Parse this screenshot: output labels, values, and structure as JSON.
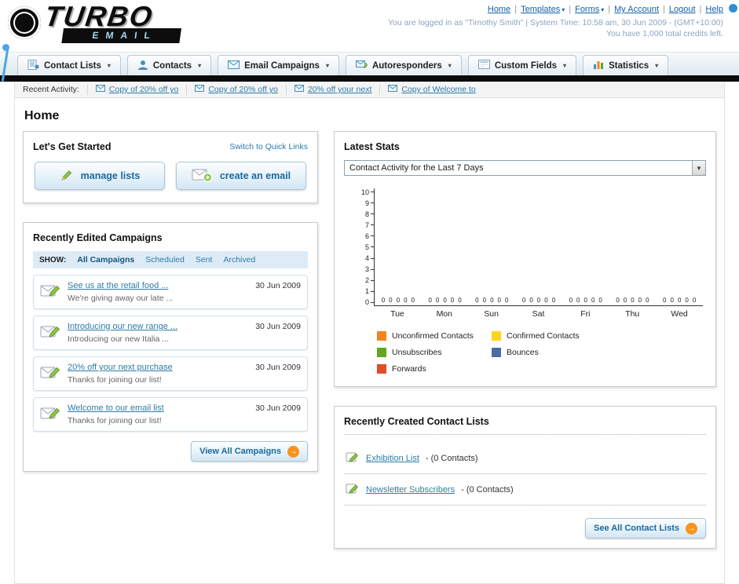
{
  "header": {
    "logo_title": "TURBO",
    "logo_subtitle": "EMAIL",
    "nav": {
      "items": [
        {
          "label": "Home",
          "has_dropdown": false
        },
        {
          "label": "Templates",
          "has_dropdown": true
        },
        {
          "label": "Forms",
          "has_dropdown": true
        },
        {
          "label": "My Account",
          "has_dropdown": false
        },
        {
          "label": "Logout",
          "has_dropdown": false
        },
        {
          "label": "Help",
          "has_dropdown": false
        }
      ]
    },
    "session_line": "You are logged in as \"Timothy Smith\" | System Time: 10:58 am, 30 Jun 2009 - (GMT+10:00)",
    "credits_line": "You have 1,000 total credits left."
  },
  "main_nav": {
    "tabs": [
      {
        "label": "Contact Lists",
        "icon": "contact-lists-icon"
      },
      {
        "label": "Contacts",
        "icon": "contacts-icon"
      },
      {
        "label": "Email Campaigns",
        "icon": "email-campaigns-icon"
      },
      {
        "label": "Autoresponders",
        "icon": "autoresponders-icon"
      },
      {
        "label": "Custom Fields",
        "icon": "custom-fields-icon"
      },
      {
        "label": "Statistics",
        "icon": "statistics-icon"
      }
    ]
  },
  "recent_activity": {
    "label": "Recent Activity:",
    "items": [
      "Copy of 20% off yo",
      "Copy of 20% off yo",
      "20% off your next",
      "Copy of Welcome to"
    ]
  },
  "page": {
    "title": "Home"
  },
  "get_started": {
    "title": "Let's Get Started",
    "switch_link": "Switch to Quick Links",
    "manage_lists_button": "manage lists",
    "create_email_button": "create an email"
  },
  "campaigns": {
    "title": "Recently Edited Campaigns",
    "show_label": "SHOW:",
    "filters": [
      "All Campaigns",
      "Scheduled",
      "Sent",
      "Archived"
    ],
    "active_filter": "All Campaigns",
    "items": [
      {
        "title": "See us at the retail food ...",
        "subtitle": "We're giving away our late ...",
        "date": "30 Jun 2009"
      },
      {
        "title": "Introducing our new range ...",
        "subtitle": "Introducing our new Italia ...",
        "date": "30 Jun 2009"
      },
      {
        "title": "20% off your next purchase",
        "subtitle": "Thanks for joining our list!",
        "date": "30 Jun 2009"
      },
      {
        "title": "Welcome to our email list",
        "subtitle": "Thanks for joining our list!",
        "date": "30 Jun 2009"
      }
    ],
    "view_all_button": "View All Campaigns"
  },
  "stats": {
    "title": "Latest Stats",
    "selected_filter": "Contact Activity for the Last 7 Days",
    "chart_data": {
      "type": "bar",
      "title": "Contact Activity for the Last 7 Days",
      "categories": [
        "Tue",
        "Mon",
        "Sun",
        "Sat",
        "Fri",
        "Thu",
        "Wed"
      ],
      "series": [
        {
          "name": "Unconfirmed Contacts",
          "color": "#F58220",
          "values": [
            0,
            0,
            0,
            0,
            0,
            0,
            0
          ]
        },
        {
          "name": "Confirmed Contacts",
          "color": "#FFD21E",
          "values": [
            0,
            0,
            0,
            0,
            0,
            0,
            0
          ]
        },
        {
          "name": "Unsubscribes",
          "color": "#61A521",
          "values": [
            0,
            0,
            0,
            0,
            0,
            0,
            0
          ]
        },
        {
          "name": "Bounces",
          "color": "#4A6DA7",
          "values": [
            0,
            0,
            0,
            0,
            0,
            0,
            0
          ]
        },
        {
          "name": "Forwards",
          "color": "#E04E26",
          "values": [
            0,
            0,
            0,
            0,
            0,
            0,
            0
          ]
        }
      ],
      "ylim": [
        0,
        10
      ],
      "yticks": [
        0,
        1,
        2,
        3,
        4,
        5,
        6,
        7,
        8,
        9,
        10
      ],
      "grid": false,
      "legend_position": "bottom"
    }
  },
  "contact_lists": {
    "title": "Recently Created Contact Lists",
    "items": [
      {
        "name": "Exhibition List",
        "suffix": "- (0 Contacts)"
      },
      {
        "name": "Newsletter Subscribers",
        "suffix": "- (0 Contacts)"
      }
    ],
    "see_all_button": "See All Contact Lists"
  }
}
